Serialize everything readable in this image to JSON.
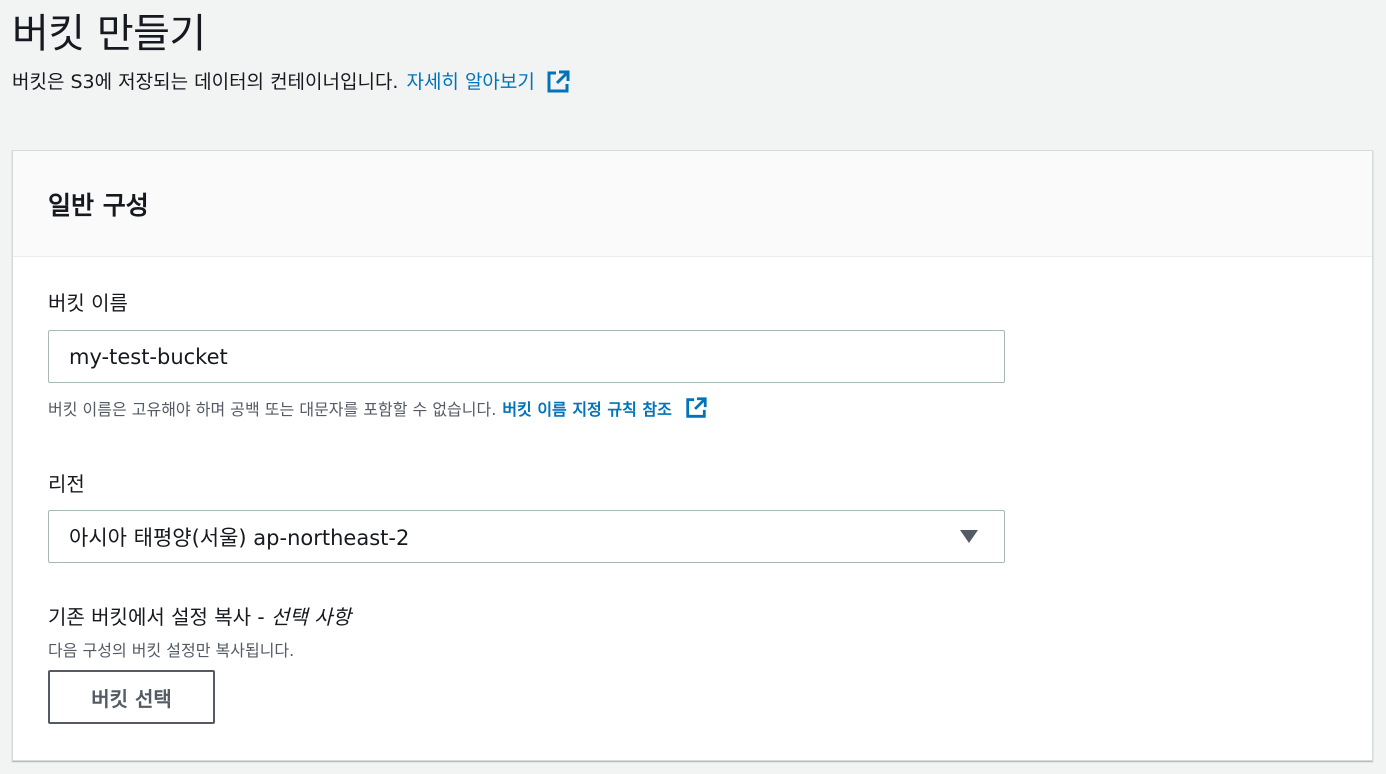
{
  "page": {
    "title": "버킷 만들기",
    "description": "버킷은 S3에 저장되는 데이터의 컨테이너입니다.",
    "learn_more": "자세히 알아보기",
    "external_icon": "external-link-icon"
  },
  "panel": {
    "title": "일반 구성",
    "bucket_name": {
      "label": "버킷 이름",
      "value": "my-test-bucket",
      "hint": "버킷 이름은 고유해야 하며 공백 또는 대문자를 포함할 수 없습니다.",
      "hint_link": "버킷 이름 지정 규칙 참조"
    },
    "region": {
      "label": "리전",
      "value": "아시아 태평양(서울) ap-northeast-2"
    },
    "copy_settings": {
      "label": "기존 버킷에서 설정 복사 - ",
      "optional": "선택 사항",
      "description": "다음 구성의 버킷 설정만 복사됩니다.",
      "button": "버킷 선택"
    }
  },
  "colors": {
    "accent": "#0073bb",
    "background": "#f2f3f3",
    "text": "#16191f",
    "secondary_text": "#545b64"
  }
}
